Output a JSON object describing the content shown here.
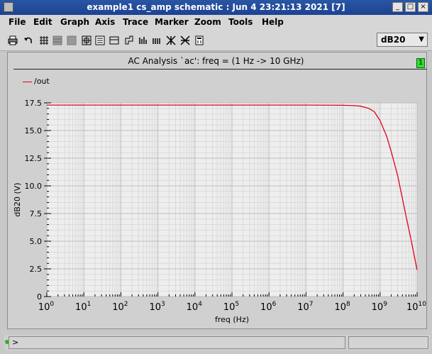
{
  "window": {
    "title": "example1 cs_amp schematic :  Jun  4 23:21:13 2021 [7]",
    "minimize": "_",
    "maximize": "□",
    "close": "×"
  },
  "menu": [
    {
      "label": "File"
    },
    {
      "label": "Edit"
    },
    {
      "label": "Graph"
    },
    {
      "label": "Axis"
    },
    {
      "label": "Trace"
    },
    {
      "label": "Marker"
    },
    {
      "label": "Zoom"
    },
    {
      "label": "Tools"
    },
    {
      "label": "Help"
    }
  ],
  "toolbar": {
    "icons": [
      "printer-icon",
      "undo-icon",
      "grid-icon",
      "strip-mode-icon",
      "composite-mode-icon",
      "zoom-fit-icon",
      "redraw-icon",
      "axis-icon",
      "label-icon",
      "bars-icon",
      "add-marker-icon",
      "delete-marker-icon",
      "calculator-icon"
    ],
    "unit_select": "dB20",
    "unit_arrow": "▼"
  },
  "graph": {
    "title": "AC Analysis `ac': freq = (1 Hz -> 10 GHz)",
    "badge": "1",
    "legend": "/out"
  },
  "status": {
    "prompt": ">"
  },
  "chart_data": {
    "type": "line",
    "title": "AC Analysis `ac': freq = (1 Hz -> 10 GHz)",
    "xlabel": "freq (Hz)",
    "ylabel": "dB20 (V)",
    "xscale": "log",
    "xlim": [
      1,
      10000000000
    ],
    "ylim": [
      0,
      17.5
    ],
    "x_ticks": [
      {
        "base": "10",
        "exp": "0"
      },
      {
        "base": "10",
        "exp": "1"
      },
      {
        "base": "10",
        "exp": "2"
      },
      {
        "base": "10",
        "exp": "3"
      },
      {
        "base": "10",
        "exp": "4"
      },
      {
        "base": "10",
        "exp": "5"
      },
      {
        "base": "10",
        "exp": "6"
      },
      {
        "base": "10",
        "exp": "7"
      },
      {
        "base": "10",
        "exp": "8"
      },
      {
        "base": "10",
        "exp": "9"
      },
      {
        "base": "10",
        "exp": "10"
      }
    ],
    "y_ticks": [
      "0",
      "2.5",
      "5.0",
      "7.5",
      "10.0",
      "12.5",
      "15.0",
      "17.5"
    ],
    "grid": true,
    "legend_position": "top-left",
    "series": [
      {
        "name": "/out",
        "color": "#e0001a",
        "x": [
          1,
          10,
          100,
          1000,
          10000,
          100000,
          1000000,
          10000000,
          100000000,
          200000000,
          300000000,
          500000000,
          700000000,
          1000000000,
          1500000000,
          2000000000,
          3000000000,
          5000000000,
          7000000000,
          10000000000
        ],
        "y": [
          17.3,
          17.3,
          17.3,
          17.3,
          17.3,
          17.3,
          17.3,
          17.3,
          17.28,
          17.25,
          17.2,
          17.0,
          16.7,
          15.9,
          14.5,
          13.1,
          10.9,
          7.3,
          5.0,
          2.4
        ]
      }
    ]
  }
}
